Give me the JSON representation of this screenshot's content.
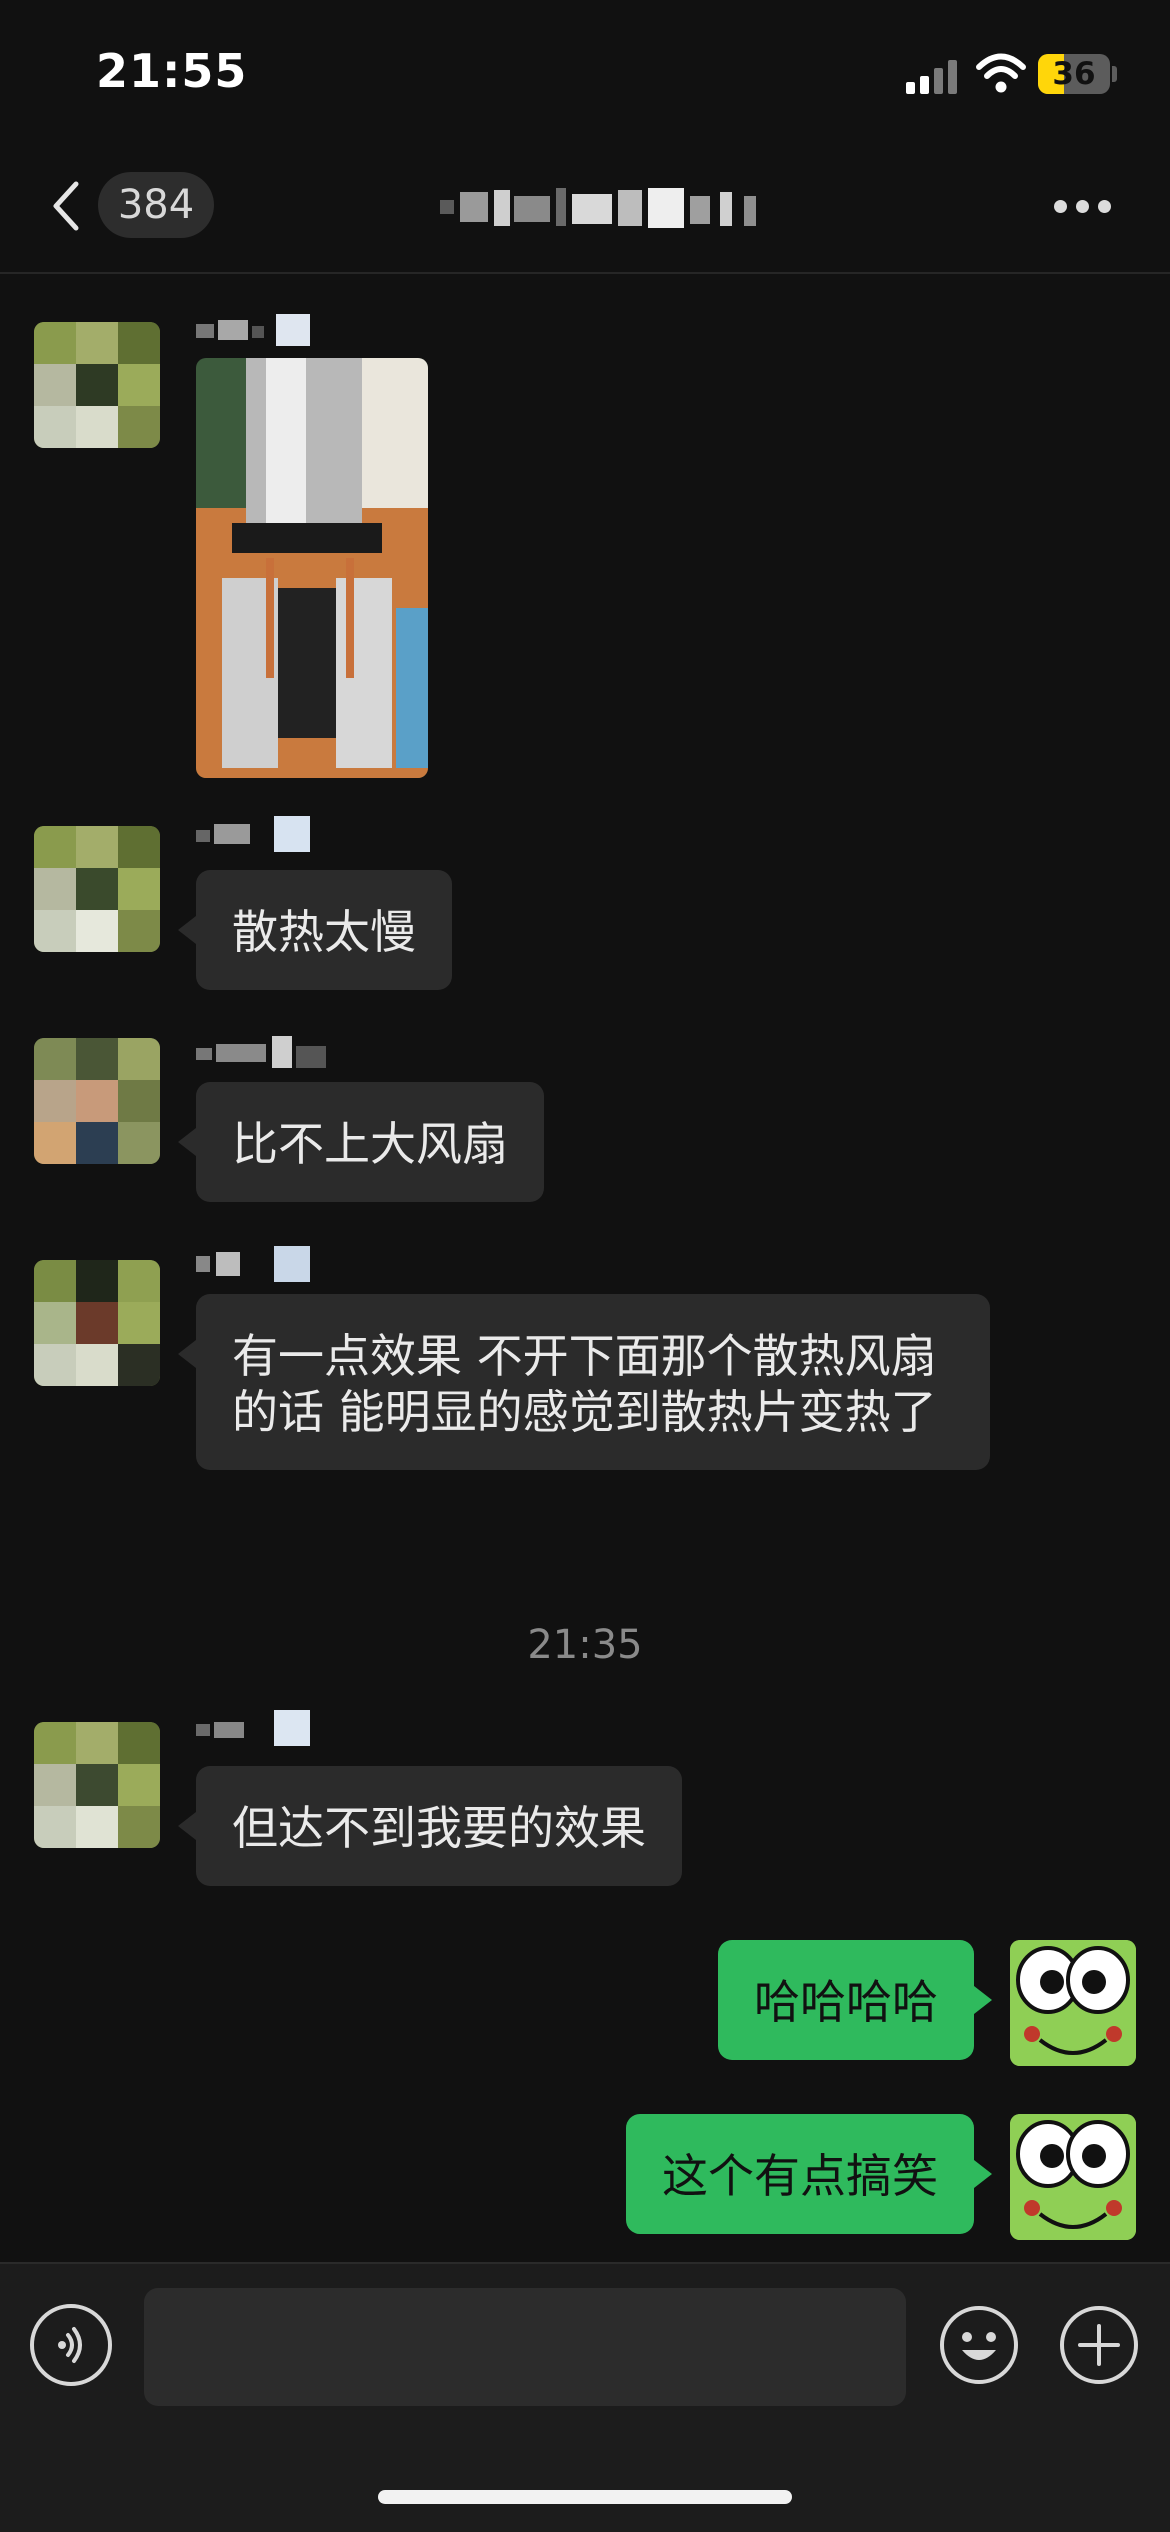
{
  "status_bar": {
    "time": "21:55",
    "battery": "36"
  },
  "nav": {
    "unread_count": "384"
  },
  "messages": [
    {
      "type": "image"
    },
    {
      "text": "散热太慢"
    },
    {
      "text": "比不上大风扇"
    },
    {
      "text": "有一点效果 不开下面那个散热风扇的话 能明显的感觉到散热片变热了"
    },
    {
      "timestamp": "21:35"
    },
    {
      "text": "但达不到我要的效果"
    },
    {
      "text": "哈哈哈哈"
    },
    {
      "text": "这个有点搞笑"
    }
  ],
  "colors": {
    "background": "#111111",
    "incoming_bubble": "#2b2b2b",
    "outgoing_bubble": "#2fba5d",
    "battery": "#ffd60a"
  },
  "icons": [
    "back-icon",
    "more-icon",
    "voice-icon",
    "emoji-icon",
    "plus-icon",
    "wifi-icon",
    "signal-icon"
  ]
}
